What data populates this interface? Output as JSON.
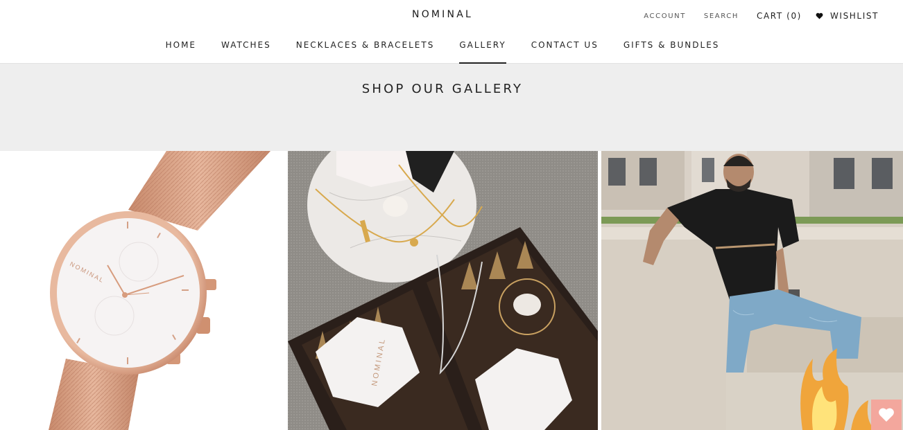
{
  "header": {
    "brand": "NOMINAL",
    "account": "ACCOUNT",
    "search": "SEARCH",
    "cart": "CART (0)",
    "wishlist": "WISHLIST"
  },
  "nav": {
    "items": [
      {
        "label": "HOME"
      },
      {
        "label": "WATCHES"
      },
      {
        "label": "NECKLACES & BRACELETS"
      },
      {
        "label": "GALLERY",
        "active": true
      },
      {
        "label": "CONTACT US"
      },
      {
        "label": "GIFTS & BUNDLES"
      }
    ]
  },
  "gallery": {
    "title": "SHOP OUR GALLERY",
    "tiles": [
      {
        "label": "NOMINAL"
      },
      {
        "label": "NOMINAL"
      },
      {
        "label": ""
      }
    ]
  },
  "icons": {
    "wishlist_heart": "heart-icon",
    "float_heart": "heart-icon"
  },
  "colors": {
    "band_bg": "#eeeeee",
    "accent_rose": "#d9a083",
    "float_bg": "#f3a79d"
  }
}
